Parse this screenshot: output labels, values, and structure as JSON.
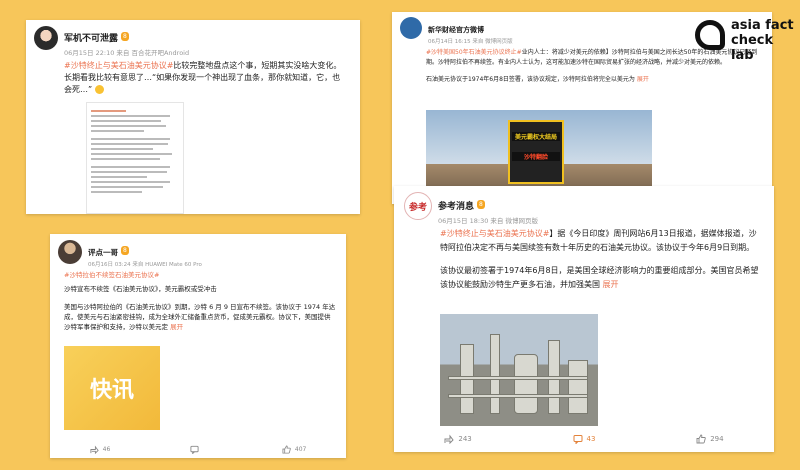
{
  "logo": {
    "line1": "asia fact",
    "line2": "check lab"
  },
  "card1": {
    "username": "军机不可泄露",
    "badge": "8",
    "meta": "06月15日 22:10  来自 百合花开吧Android",
    "tag": "#沙特终止与美石油美元协议#",
    "text1": "比较完整地盘点这个事，短期其实没啥大变化。长期看我比较有意思了…",
    "text2": "“如果你发现一个神出现了血条，那你就知道，它，也会死…”"
  },
  "card2": {
    "username": "新华财经官方微博",
    "meta": "06月14日 16:15  来自 微博网页版",
    "tag": "#沙特美国50年石油美元协议终止#",
    "text1": "业内人士：将减少对美元的依赖】沙特阿拉伯与美国之间长达50年的石油美元协议已经到期。沙特阿拉伯不再续签。有业内人士认为，这可能加速沙特在国际贸易扩张的经济战略，并减少对美元的依赖。",
    "text2": "石油美元协议于1974年6月8日签署，该协议规定，沙特阿拉伯将完全以美元为",
    "more": "展开",
    "video_cap1": "美元霸权大结局",
    "video_cap2": "沙特翻脸"
  },
  "card3": {
    "username": "评点一哥",
    "badge": "8",
    "meta": "06月16日 03:24  来自 HUAWEI Mate 60 Pro",
    "tag": "#沙特拉伯不续签石油美元协议#",
    "p1": "沙特宣布不续签《石油美元协议》，美元霸权或受冲击",
    "p2": "美国与沙特阿拉伯的《石油美元协议》到期，沙特 6 月 9 日宣布不续签。该协议于 1974 年达成，使美元与石油紧密挂钩，成为全球外汇储备重点货币，促成美元霸权。协议下，美国提供沙特军事保护和支持，沙特以美元定",
    "more": "展开",
    "image_text": "快讯",
    "share": "46",
    "comments": "",
    "likes": "407"
  },
  "card4": {
    "username": "参考消息",
    "badge": "8",
    "meta": "06月15日 18:30  来自 微博网页版",
    "tag": "#沙特终止与美石油美元协议#",
    "p1": "】据《今日印度》周刊网站6月13日报道，据媒体报道，沙特阿拉伯决定不再与美国续签有数十年历史的石油美元协议。该协议于今年6月9日到期。",
    "p2": "该协议最初签署于1974年6月8日，是美国全球经济影响力的重要组成部分。美国官员希望该协议能鼓励沙特生产更多石油，并加强美国",
    "more": "展开",
    "avatar_text": "参考",
    "share": "243",
    "comments": "43",
    "likes": "294"
  }
}
